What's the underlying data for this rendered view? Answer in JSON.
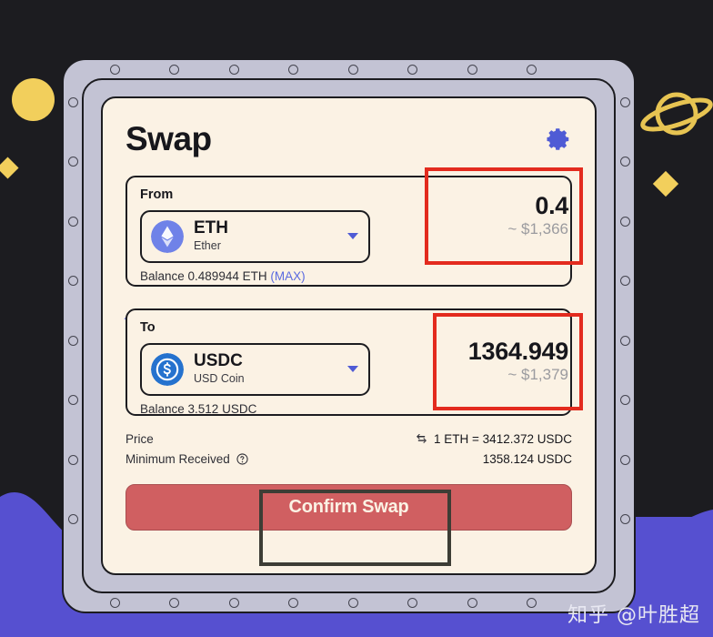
{
  "header": {
    "title": "Swap",
    "settings_icon": "gear-icon"
  },
  "from": {
    "label": "From",
    "token_symbol": "ETH",
    "token_name": "Ether",
    "token_icon": "ethereum-icon",
    "balance_text": "Balance 0.489944 ETH",
    "max_label": "(MAX)",
    "amount": "0.4",
    "fiat": "~ $1,366"
  },
  "swap_toggle": {
    "icon": "swap-arrows-icon"
  },
  "to": {
    "label": "To",
    "token_symbol": "USDC",
    "token_name": "USD Coin",
    "token_icon": "usdc-icon",
    "balance_text": "Balance 3.512 USDC",
    "amount": "1364.949",
    "fiat": "~ $1,379"
  },
  "info": {
    "price_label": "Price",
    "price_value": "1 ETH = 3412.372 USDC",
    "price_swap_icon": "exchange-arrows-icon",
    "minimum_label": "Minimum Received",
    "minimum_help_icon": "question-circle-icon",
    "minimum_value": "1358.124 USDC"
  },
  "action": {
    "confirm_label": "Confirm Swap"
  },
  "watermark": {
    "text": "知乎 @叶胜超"
  },
  "colors": {
    "accent_blue": "#4f5bd5",
    "card_bg": "#fbf2e4",
    "frame": "#c3c3d4",
    "button_red": "#d05f61",
    "annotation_red": "#e32b1e",
    "annotation_dark": "#3d3d35",
    "background_dark": "#1c1c20",
    "background_purple": "#5650d0",
    "decoration_yellow": "#f2cf5c"
  },
  "decorations": [
    "yellow-circle",
    "yellow-diamond-left",
    "saturn-planet-outline",
    "yellow-diamond-right",
    "purple-wave"
  ]
}
